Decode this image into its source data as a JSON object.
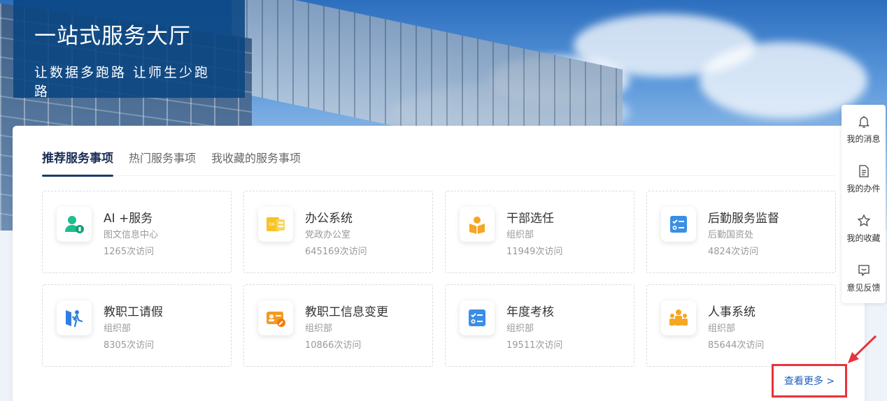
{
  "banner": {
    "title": "一站式服务大厅",
    "subtitle": "让数据多跑路 让师生少跑路"
  },
  "tabs": [
    {
      "label": "推荐服务事项",
      "active": true
    },
    {
      "label": "热门服务事项",
      "active": false
    },
    {
      "label": "我收藏的服务事项",
      "active": false
    }
  ],
  "services": [
    {
      "name": "AI +服务",
      "dept": "图文信息中心",
      "visits": "1265次访问",
      "icon": "ai-user-icon",
      "color": "#1dbf8f"
    },
    {
      "name": "办公系统",
      "dept": "党政办公室",
      "visits": "645169次访问",
      "icon": "oa-doc-icon",
      "color": "#f7c325"
    },
    {
      "name": "干部选任",
      "dept": "组织部",
      "visits": "11949次访问",
      "icon": "cadre-icon",
      "color": "#f5a623"
    },
    {
      "name": "后勤服务监督",
      "dept": "后勤国资处",
      "visits": "4824次访问",
      "icon": "checklist-icon",
      "color": "#3a8ee6"
    },
    {
      "name": "教职工请假",
      "dept": "组织部",
      "visits": "8305次访问",
      "icon": "leave-icon",
      "color": "#2f7fe0"
    },
    {
      "name": "教职工信息变更",
      "dept": "组织部",
      "visits": "10866次访问",
      "icon": "id-card-edit-icon",
      "color": "#f59a23"
    },
    {
      "name": "年度考核",
      "dept": "组织部",
      "visits": "19511次访问",
      "icon": "assessment-icon",
      "color": "#3a8ee6"
    },
    {
      "name": "人事系统",
      "dept": "组织部",
      "visits": "85644次访问",
      "icon": "people-group-icon",
      "color": "#f5a623"
    }
  ],
  "more_label": "查看更多 >",
  "side_toolbar": [
    {
      "label": "我的消息",
      "icon": "bell-icon"
    },
    {
      "label": "我的办件",
      "icon": "document-icon"
    },
    {
      "label": "我的收藏",
      "icon": "star-icon"
    },
    {
      "label": "意见反馈",
      "icon": "feedback-icon"
    }
  ],
  "colors": {
    "accent": "#1a3c6e",
    "link": "#1f5fbf",
    "highlight": "#e8333a",
    "banner_box": "#0a4682"
  }
}
